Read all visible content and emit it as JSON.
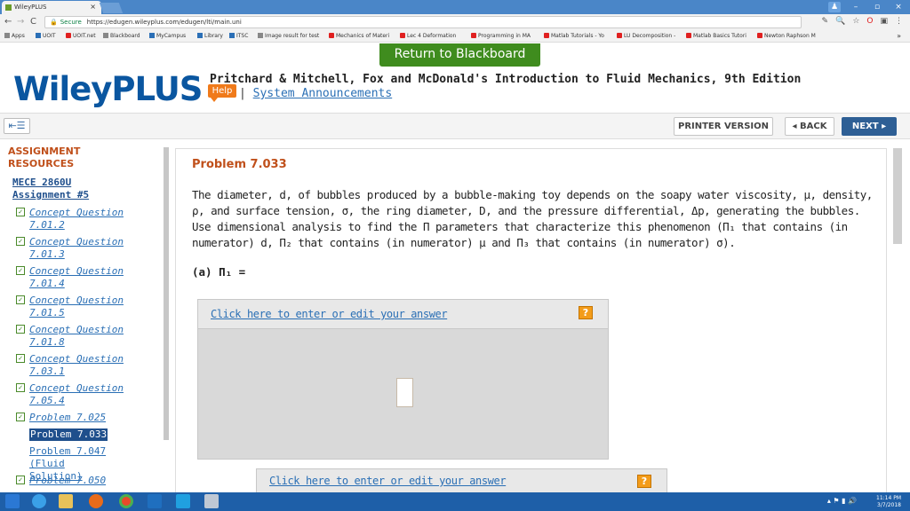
{
  "browser": {
    "tab_title": "WileyPLUS",
    "tab_close": "×",
    "url_secure": "Secure",
    "url": "https://edugen.wileyplus.com/edugen/lti/main.uni",
    "nav": {
      "back": "←",
      "forward": "→",
      "reload": "C"
    },
    "window_controls": {
      "user": "♟",
      "minimize": "–",
      "maximize": "▫",
      "close": "×"
    },
    "extension_icons": [
      "✎",
      "🔍",
      "☆",
      "O",
      "▣",
      "⋮"
    ],
    "bookmarks": [
      {
        "label": "Apps",
        "icon": "apps-icon"
      },
      {
        "label": "UOIT",
        "icon": "uoit-icon"
      },
      {
        "label": "UOIT.net",
        "icon": "gmail-icon"
      },
      {
        "label": "Blackboard",
        "icon": "blackboard-icon"
      },
      {
        "label": "MyCampus",
        "icon": "uoit-icon"
      },
      {
        "label": "Library",
        "icon": "uoit-icon"
      },
      {
        "label": "ITSC",
        "icon": "uoit-icon"
      },
      {
        "label": "Image result for test",
        "icon": "google-icon"
      },
      {
        "label": "Mechanics of Materi",
        "icon": "youtube-icon"
      },
      {
        "label": "Lec 4 Deformation",
        "icon": "youtube-icon"
      },
      {
        "label": "Programming in MA",
        "icon": "youtube-icon"
      },
      {
        "label": "Matlab Tutorials - Yo",
        "icon": "youtube-icon"
      },
      {
        "label": "LU Decomposition -",
        "icon": "youtube-icon"
      },
      {
        "label": "Matlab Basics Tutori",
        "icon": "youtube-icon"
      },
      {
        "label": "Newton Raphson M",
        "icon": "youtube-icon"
      }
    ],
    "bookmarks_more": "»"
  },
  "header": {
    "return_label": "Return to Blackboard",
    "logo": "WileyPLUS",
    "help_label": "Help",
    "book_title": "Pritchard & Mitchell, Fox and McDonald's Introduction to Fluid Mechanics, 9th Edition",
    "sep": "|",
    "system_announcements": "System Announcements"
  },
  "toolbar": {
    "collapse_icon": "⇤☰",
    "printer_label": "PRINTER VERSION",
    "back_label": "◂ BACK",
    "next_label": "NEXT ▸"
  },
  "sidebar": {
    "heading_line1": "ASSIGNMENT",
    "heading_line2": "RESOURCES",
    "course_line1": "MECE 2860U",
    "course_line2": "Assignment #5",
    "checkmark": "✓",
    "items": [
      {
        "line1": "Concept Question",
        "line2": "7.01.2",
        "checked": true
      },
      {
        "line1": "Concept Question",
        "line2": "7.01.3",
        "checked": true
      },
      {
        "line1": "Concept Question",
        "line2": "7.01.4",
        "checked": true
      },
      {
        "line1": "Concept Question",
        "line2": "7.01.5",
        "checked": true
      },
      {
        "line1": "Concept Question",
        "line2": "7.01.8",
        "checked": true
      },
      {
        "line1": "Concept Question",
        "line2": "7.03.1",
        "checked": true
      },
      {
        "line1": "Concept Question",
        "line2": "7.05.4",
        "checked": true
      },
      {
        "line1": "Problem 7.025",
        "line2": "",
        "checked": true
      },
      {
        "line1": "Problem 7.033",
        "line2": "",
        "checked": false,
        "current": true
      },
      {
        "line1": "Problem 7.047 (Fluid",
        "line2": "Solution)",
        "checked": false
      },
      {
        "line1": "Problem 7.050",
        "line2": "",
        "checked": true
      }
    ]
  },
  "problem": {
    "title": "Problem 7.033",
    "text": "The diameter, d, of bubbles produced by a bubble-making toy depends on the soapy water viscosity, μ, density, ρ, and surface tension, σ, the ring diameter, D, and the pressure differential, Δp, generating the bubbles. Use dimensional analysis to find the Π parameters that characterize this phenomenon (Π₁ that contains (in numerator) d, Π₂ that contains (in numerator) μ and Π₃ that contains (in numerator) σ).",
    "part_a": "(a) Π₁ =",
    "answer_link": "Click here to enter or edit your answer",
    "help_q": "?"
  },
  "taskbar": {
    "time": "11:14 PM",
    "date": "3/7/2018",
    "tray": "▴ ⚑ ▮ 🔊"
  }
}
